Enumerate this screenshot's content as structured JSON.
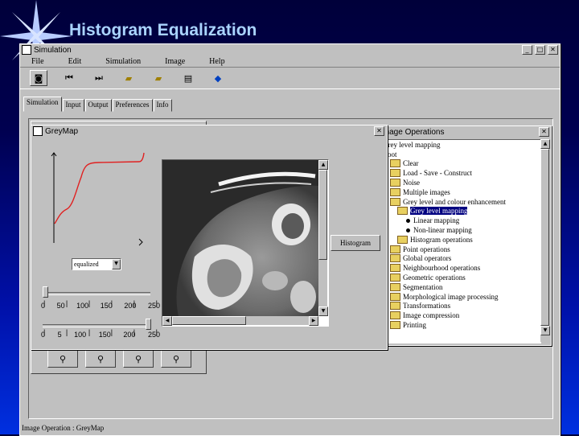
{
  "slide": {
    "title": "Histogram Equalization"
  },
  "main_window": {
    "title": "Simulation",
    "menu": [
      "File",
      "Edit",
      "Simulation",
      "Image",
      "Help"
    ],
    "tabs": [
      "Simulation",
      "Input",
      "Output",
      "Preferences",
      "Info"
    ],
    "status_bar": "Image Operation : GreyMap"
  },
  "image_ops_window": {
    "title": "Image Operations",
    "tree": [
      {
        "label": "Grey level mapping",
        "level": 0,
        "kind": "text"
      },
      {
        "label": "Root",
        "level": 0,
        "kind": "text"
      },
      {
        "label": "Clear",
        "level": 1,
        "kind": "folder"
      },
      {
        "label": "Load - Save - Construct",
        "level": 1,
        "kind": "folder"
      },
      {
        "label": "Noise",
        "level": 1,
        "kind": "folder"
      },
      {
        "label": "Multiple images",
        "level": 1,
        "kind": "folder"
      },
      {
        "label": "Grey level and colour enhancement",
        "level": 1,
        "kind": "folder"
      },
      {
        "label": "Grey level mapping",
        "level": 2,
        "kind": "folder",
        "selected": true
      },
      {
        "label": "Linear mapping",
        "level": 3,
        "kind": "leaf"
      },
      {
        "label": "Non-linear mapping",
        "level": 3,
        "kind": "leaf"
      },
      {
        "label": "Histogram operations",
        "level": 2,
        "kind": "folder"
      },
      {
        "label": "Point operations",
        "level": 1,
        "kind": "folder"
      },
      {
        "label": "Global operators",
        "level": 1,
        "kind": "folder"
      },
      {
        "label": "Neighbourhood operations",
        "level": 1,
        "kind": "folder"
      },
      {
        "label": "Geometric operations",
        "level": 1,
        "kind": "folder"
      },
      {
        "label": "Segmentation",
        "level": 1,
        "kind": "folder"
      },
      {
        "label": "Morphological image processing",
        "level": 1,
        "kind": "folder"
      },
      {
        "label": "Transformations",
        "level": 1,
        "kind": "folder"
      },
      {
        "label": "Image compression",
        "level": 1,
        "kind": "folder"
      },
      {
        "label": "Printing",
        "level": 1,
        "kind": "folder"
      }
    ]
  },
  "greymap_window": {
    "title": "GreyMap",
    "mapping_select": "equalized",
    "histogram_button": "Histogram",
    "slider1_ticks": [
      "0",
      "50",
      "100",
      "150",
      "200",
      "250"
    ],
    "slider2_ticks": [
      "0",
      "5",
      "100",
      "150",
      "200",
      "250"
    ],
    "curve_color": "#e02020"
  },
  "colors": {
    "background_top": "#00003a",
    "background_bottom": "#0030e0",
    "title_text": "#aad4ff",
    "selection": "#000080"
  }
}
